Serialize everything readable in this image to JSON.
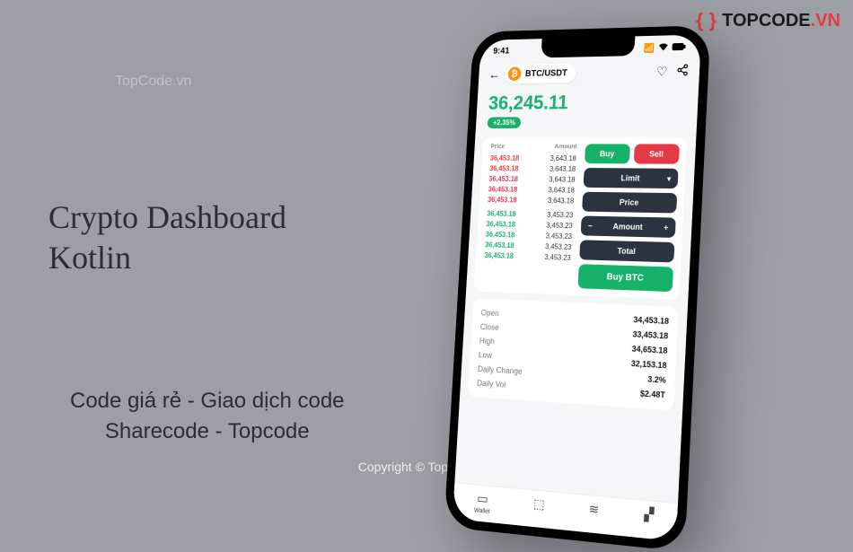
{
  "watermark_top": "TopCode.vn",
  "logo": {
    "brand": "TOPCODE",
    "suffix": ".VN"
  },
  "title": {
    "line1": "Crypto Dashboard",
    "line2": "Kotlin"
  },
  "subtitle": {
    "line1": "Code giá rẻ - Giao dịch code",
    "line2": "Sharecode - Topcode"
  },
  "copyright": "Copyright © TopCode.vn",
  "phone": {
    "status": {
      "time": "9:41",
      "signal": "•••",
      "wifi": "⌵",
      "battery": "▭"
    },
    "header": {
      "pair": "BTC/USDT",
      "coin_symbol": "₿"
    },
    "price": {
      "value": "36,245.11",
      "change": "+2.35%"
    },
    "orderbook": {
      "head_price": "Price",
      "head_amount": "Amount",
      "sells": [
        {
          "price": "36,453.18",
          "amount": "3,643.18"
        },
        {
          "price": "36,453.18",
          "amount": "3,643.18"
        },
        {
          "price": "36,453.18",
          "amount": "3,643.18"
        },
        {
          "price": "36,453.18",
          "amount": "3,643.18"
        },
        {
          "price": "36,453.18",
          "amount": "3,643.18"
        }
      ],
      "buys": [
        {
          "price": "36,453.18",
          "amount": "3,453.23"
        },
        {
          "price": "36,453.18",
          "amount": "3,453.23"
        },
        {
          "price": "36,453.18",
          "amount": "3,453.23"
        },
        {
          "price": "36,453.18",
          "amount": "3,453.23"
        },
        {
          "price": "36,453.18",
          "amount": "3,453.23"
        }
      ]
    },
    "controls": {
      "buy": "Buy",
      "sell": "Sell",
      "limit": "Limit",
      "price": "Price",
      "amount": "Amount",
      "total": "Total",
      "buy_btc": "Buy BTC"
    },
    "stats": [
      {
        "label": "Open",
        "value": "34,453.18"
      },
      {
        "label": "Close",
        "value": "33,453.18"
      },
      {
        "label": "High",
        "value": "34,653.18"
      },
      {
        "label": "Low",
        "value": "32,153.18"
      },
      {
        "label": "Daily Change",
        "value": "3.2%"
      },
      {
        "label": "Daily Vol",
        "value": "$2.48T"
      }
    ],
    "nav": {
      "wallet": "Wallet"
    }
  }
}
